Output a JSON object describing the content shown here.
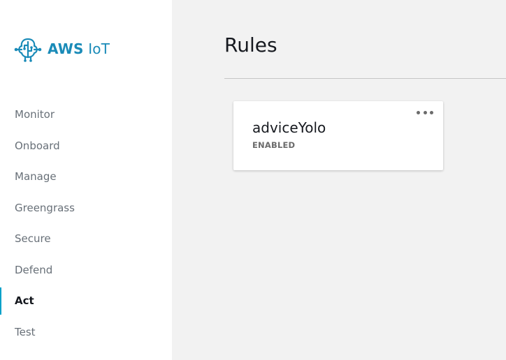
{
  "brand": {
    "name_bold": "AWS",
    "name_rest": " IoT",
    "logo_icon": "iot-brain-icon",
    "color": "#1a8bb8"
  },
  "sidebar": {
    "items": [
      {
        "label": "Monitor",
        "active": false
      },
      {
        "label": "Onboard",
        "active": false
      },
      {
        "label": "Manage",
        "active": false
      },
      {
        "label": "Greengrass",
        "active": false
      },
      {
        "label": "Secure",
        "active": false
      },
      {
        "label": "Defend",
        "active": false
      },
      {
        "label": "Act",
        "active": true
      },
      {
        "label": "Test",
        "active": false
      }
    ],
    "active_indicator_color": "#00a1c9"
  },
  "main": {
    "title": "Rules",
    "rules": [
      {
        "name": "adviceYolo",
        "status": "ENABLED",
        "menu_icon": "more-options-icon"
      }
    ]
  }
}
